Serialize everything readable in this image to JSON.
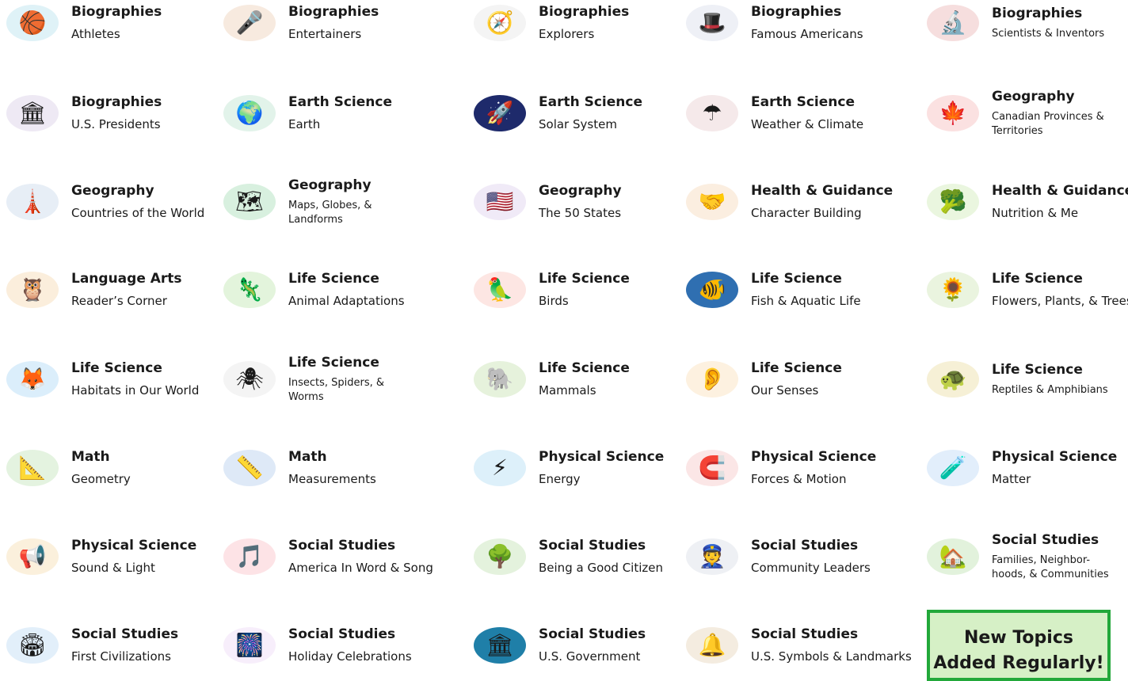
{
  "tiles": [
    {
      "category": "Biographies",
      "subject": "Athletes",
      "icon": "basketball-player-icon",
      "symbol": "🏀",
      "bg": "#dff2f7"
    },
    {
      "category": "Biographies",
      "subject": "Entertainers",
      "icon": "performer-icon",
      "symbol": "🎤",
      "bg": "#f7eadf"
    },
    {
      "category": "Biographies",
      "subject": "Explorers",
      "icon": "explorer-icon",
      "symbol": "🧭",
      "bg": "#f4f4f4"
    },
    {
      "category": "Biographies",
      "subject": "Famous Americans",
      "icon": "famous-americans-icon",
      "symbol": "🎩",
      "bg": "#eef0f6"
    },
    {
      "category": "Biographies",
      "subject": "Scientists & Inventors",
      "icon": "scientist-icon",
      "symbol": "🔬",
      "bg": "#f6dede"
    },
    {
      "category": "Biographies",
      "subject": "U.S. Presidents",
      "icon": "president-portrait-icon",
      "symbol": "🏛",
      "bg": "#eee9f4"
    },
    {
      "category": "Earth Science",
      "subject": "Earth",
      "icon": "earth-globe-icon",
      "symbol": "🌍",
      "bg": "#e2f3ea"
    },
    {
      "category": "Earth Science",
      "subject": "Solar System",
      "icon": "astronaut-icon",
      "symbol": "🚀",
      "bg": "#1e2a6b"
    },
    {
      "category": "Earth Science",
      "subject": "Weather & Climate",
      "icon": "weather-kids-icon",
      "symbol": "☂",
      "bg": "#f5e9ea"
    },
    {
      "category": "Geography",
      "subject": "Canadian Provinces & Territories",
      "icon": "canada-map-icon",
      "symbol": "🍁",
      "bg": "#fbe1e1"
    },
    {
      "category": "Geography",
      "subject": "Countries of the World",
      "icon": "world-landmarks-icon",
      "symbol": "🗼",
      "bg": "#e7eef6"
    },
    {
      "category": "Geography",
      "subject": "Maps, Globes, & Landforms",
      "icon": "map-landforms-icon",
      "symbol": "🗺",
      "bg": "#d8f0df"
    },
    {
      "category": "Geography",
      "subject": "The 50 States",
      "icon": "usa-states-map-icon",
      "symbol": "🇺🇸",
      "bg": "#f0eaf7"
    },
    {
      "category": "Health & Guidance",
      "subject": "Character Building",
      "icon": "children-group-icon",
      "symbol": "🤝",
      "bg": "#fbeee0"
    },
    {
      "category": "Health & Guidance",
      "subject": "Nutrition & Me",
      "icon": "healthy-food-icon",
      "symbol": "🥦",
      "bg": "#eaf6df"
    },
    {
      "category": "Language Arts",
      "subject": "Reader’s Corner",
      "icon": "reading-owl-icon",
      "symbol": "🦉",
      "bg": "#fbeedc"
    },
    {
      "category": "Life Science",
      "subject": "Animal Adaptations",
      "icon": "chameleon-icon",
      "symbol": "🦎",
      "bg": "#e3f4dc"
    },
    {
      "category": "Life Science",
      "subject": "Birds",
      "icon": "parrots-icon",
      "symbol": "🦜",
      "bg": "#fde6e3"
    },
    {
      "category": "Life Science",
      "subject": "Fish & Aquatic Life",
      "icon": "ocean-life-icon",
      "symbol": "🐠",
      "bg": "#2f6fb1"
    },
    {
      "category": "Life Science",
      "subject": "Flowers, Plants, & Trees",
      "icon": "garden-icon",
      "symbol": "🌻",
      "bg": "#eaf4df"
    },
    {
      "category": "Life Science",
      "subject": "Habitats in Our World",
      "icon": "habitat-animals-icon",
      "symbol": "🦊",
      "bg": "#dbeefb"
    },
    {
      "category": "Life Science",
      "subject": "Insects, Spiders, & Worms",
      "icon": "insects-icon",
      "symbol": "🕷",
      "bg": "#f4f4f4"
    },
    {
      "category": "Life Science",
      "subject": "Mammals",
      "icon": "elephant-icon",
      "symbol": "🐘",
      "bg": "#e6f2dc"
    },
    {
      "category": "Life Science",
      "subject": "Our Senses",
      "icon": "senses-children-icon",
      "symbol": "👂",
      "bg": "#fdf1e0"
    },
    {
      "category": "Life Science",
      "subject": "Reptiles & Amphibians",
      "icon": "tortoise-icon",
      "symbol": "🐢",
      "bg": "#f6f0d6"
    },
    {
      "category": "Math",
      "subject": "Geometry",
      "icon": "geometry-kids-icon",
      "symbol": "📐",
      "bg": "#e4f3e0"
    },
    {
      "category": "Math",
      "subject": "Measurements",
      "icon": "measuring-box-icon",
      "symbol": "📏",
      "bg": "#dee9f7"
    },
    {
      "category": "Physical Science",
      "subject": "Energy",
      "icon": "renewable-energy-icon",
      "symbol": "⚡",
      "bg": "#ddf0fa"
    },
    {
      "category": "Physical Science",
      "subject": "Forces & Motion",
      "icon": "magnet-icon",
      "symbol": "🧲",
      "bg": "#fbe6e6"
    },
    {
      "category": "Physical Science",
      "subject": "Matter",
      "icon": "science-kids-icon",
      "symbol": "🧪",
      "bg": "#e2eefb"
    },
    {
      "category": "Physical Science",
      "subject": "Sound & Light",
      "icon": "tin-can-phone-icon",
      "symbol": "📢",
      "bg": "#fbf0dc"
    },
    {
      "category": "Social Studies",
      "subject": "America In Word & Song",
      "icon": "american-flag-icon",
      "symbol": "🎵",
      "bg": "#fde3e6"
    },
    {
      "category": "Social Studies",
      "subject": "Being a Good Citizen",
      "icon": "community-garden-icon",
      "symbol": "🌳",
      "bg": "#e4f2dd"
    },
    {
      "category": "Social Studies",
      "subject": "Community Leaders",
      "icon": "community-helpers-icon",
      "symbol": "👮",
      "bg": "#eef0f4"
    },
    {
      "category": "Social Studies",
      "subject": "Families, Neighbor-hoods, & Communities",
      "icon": "playground-icon",
      "symbol": "🏡",
      "bg": "#e2f2dc"
    },
    {
      "category": "Social Studies",
      "subject": "First Civilizations",
      "icon": "colosseum-icon",
      "symbol": "🏟",
      "bg": "#e2effa"
    },
    {
      "category": "Social Studies",
      "subject": "Holiday Celebrations",
      "icon": "fireworks-icon",
      "symbol": "🎆",
      "bg": "#f7eefb"
    },
    {
      "category": "Social Studies",
      "subject": "U.S. Government",
      "icon": "capitol-building-icon",
      "symbol": "🏛",
      "bg": "#1f7fa8"
    },
    {
      "category": "Social Studies",
      "subject": "U.S. Symbols & Landmarks",
      "icon": "liberty-bell-icon",
      "symbol": "🔔",
      "bg": "#f4ece0"
    }
  ],
  "promo": {
    "line1": "New Topics",
    "line2": "Added Regularly!"
  },
  "colors": {
    "promo_bg": "#d6f0c6",
    "promo_border": "#22a83a"
  }
}
